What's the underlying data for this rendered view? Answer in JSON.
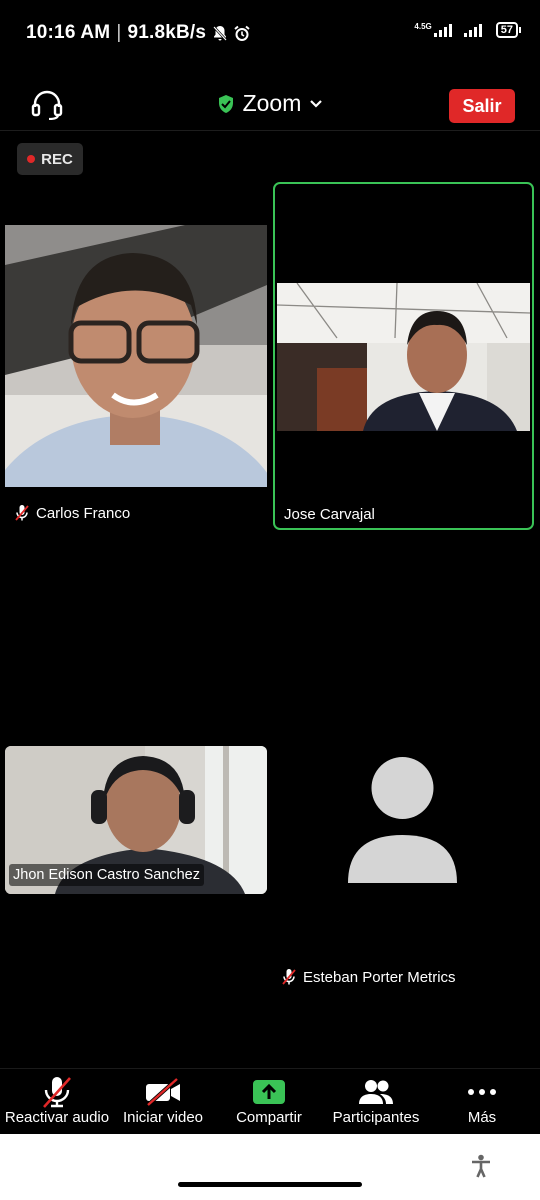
{
  "status_bar": {
    "time": "10:16 AM",
    "speed": "91.8kB/s",
    "network_type": "4.5G",
    "battery": "57"
  },
  "top_bar": {
    "title": "Zoom",
    "leave_label": "Salir",
    "headset_icon": "headset-icon",
    "shield_icon": "shield-check-icon"
  },
  "recording": {
    "label": "REC"
  },
  "participants": [
    {
      "name": "Carlos Franco",
      "muted": true,
      "video": true
    },
    {
      "name": "Jose Carvajal",
      "muted": false,
      "video": true,
      "active_speaker": true
    },
    {
      "name": "Jhon Edison Castro Sanchez",
      "muted": false,
      "video": true
    },
    {
      "name": "Esteban Porter Metrics",
      "muted": true,
      "video": false
    }
  ],
  "toolbar": {
    "audio_label": "Reactivar audio",
    "video_label": "Iniciar video",
    "share_label": "Compartir",
    "participants_label": "Participantes",
    "more_label": "Más"
  },
  "colors": {
    "accent_green": "#3ac356",
    "leave_red": "#e02828",
    "background": "#000000"
  }
}
